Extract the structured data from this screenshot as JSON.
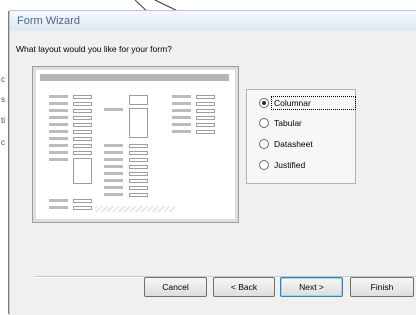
{
  "window": {
    "title": "Form Wizard"
  },
  "prompt": "What layout would you like for your form?",
  "layout_options": [
    {
      "label": "Columnar",
      "selected": true
    },
    {
      "label": "Tabular",
      "selected": false
    },
    {
      "label": "Datasheet",
      "selected": false
    },
    {
      "label": "Justified",
      "selected": false
    }
  ],
  "buttons": {
    "cancel": "Cancel",
    "back": "< Back",
    "next": "Next >",
    "finish": "Finish"
  },
  "background_fragments": [
    "c",
    "s",
    "ti",
    "c"
  ]
}
